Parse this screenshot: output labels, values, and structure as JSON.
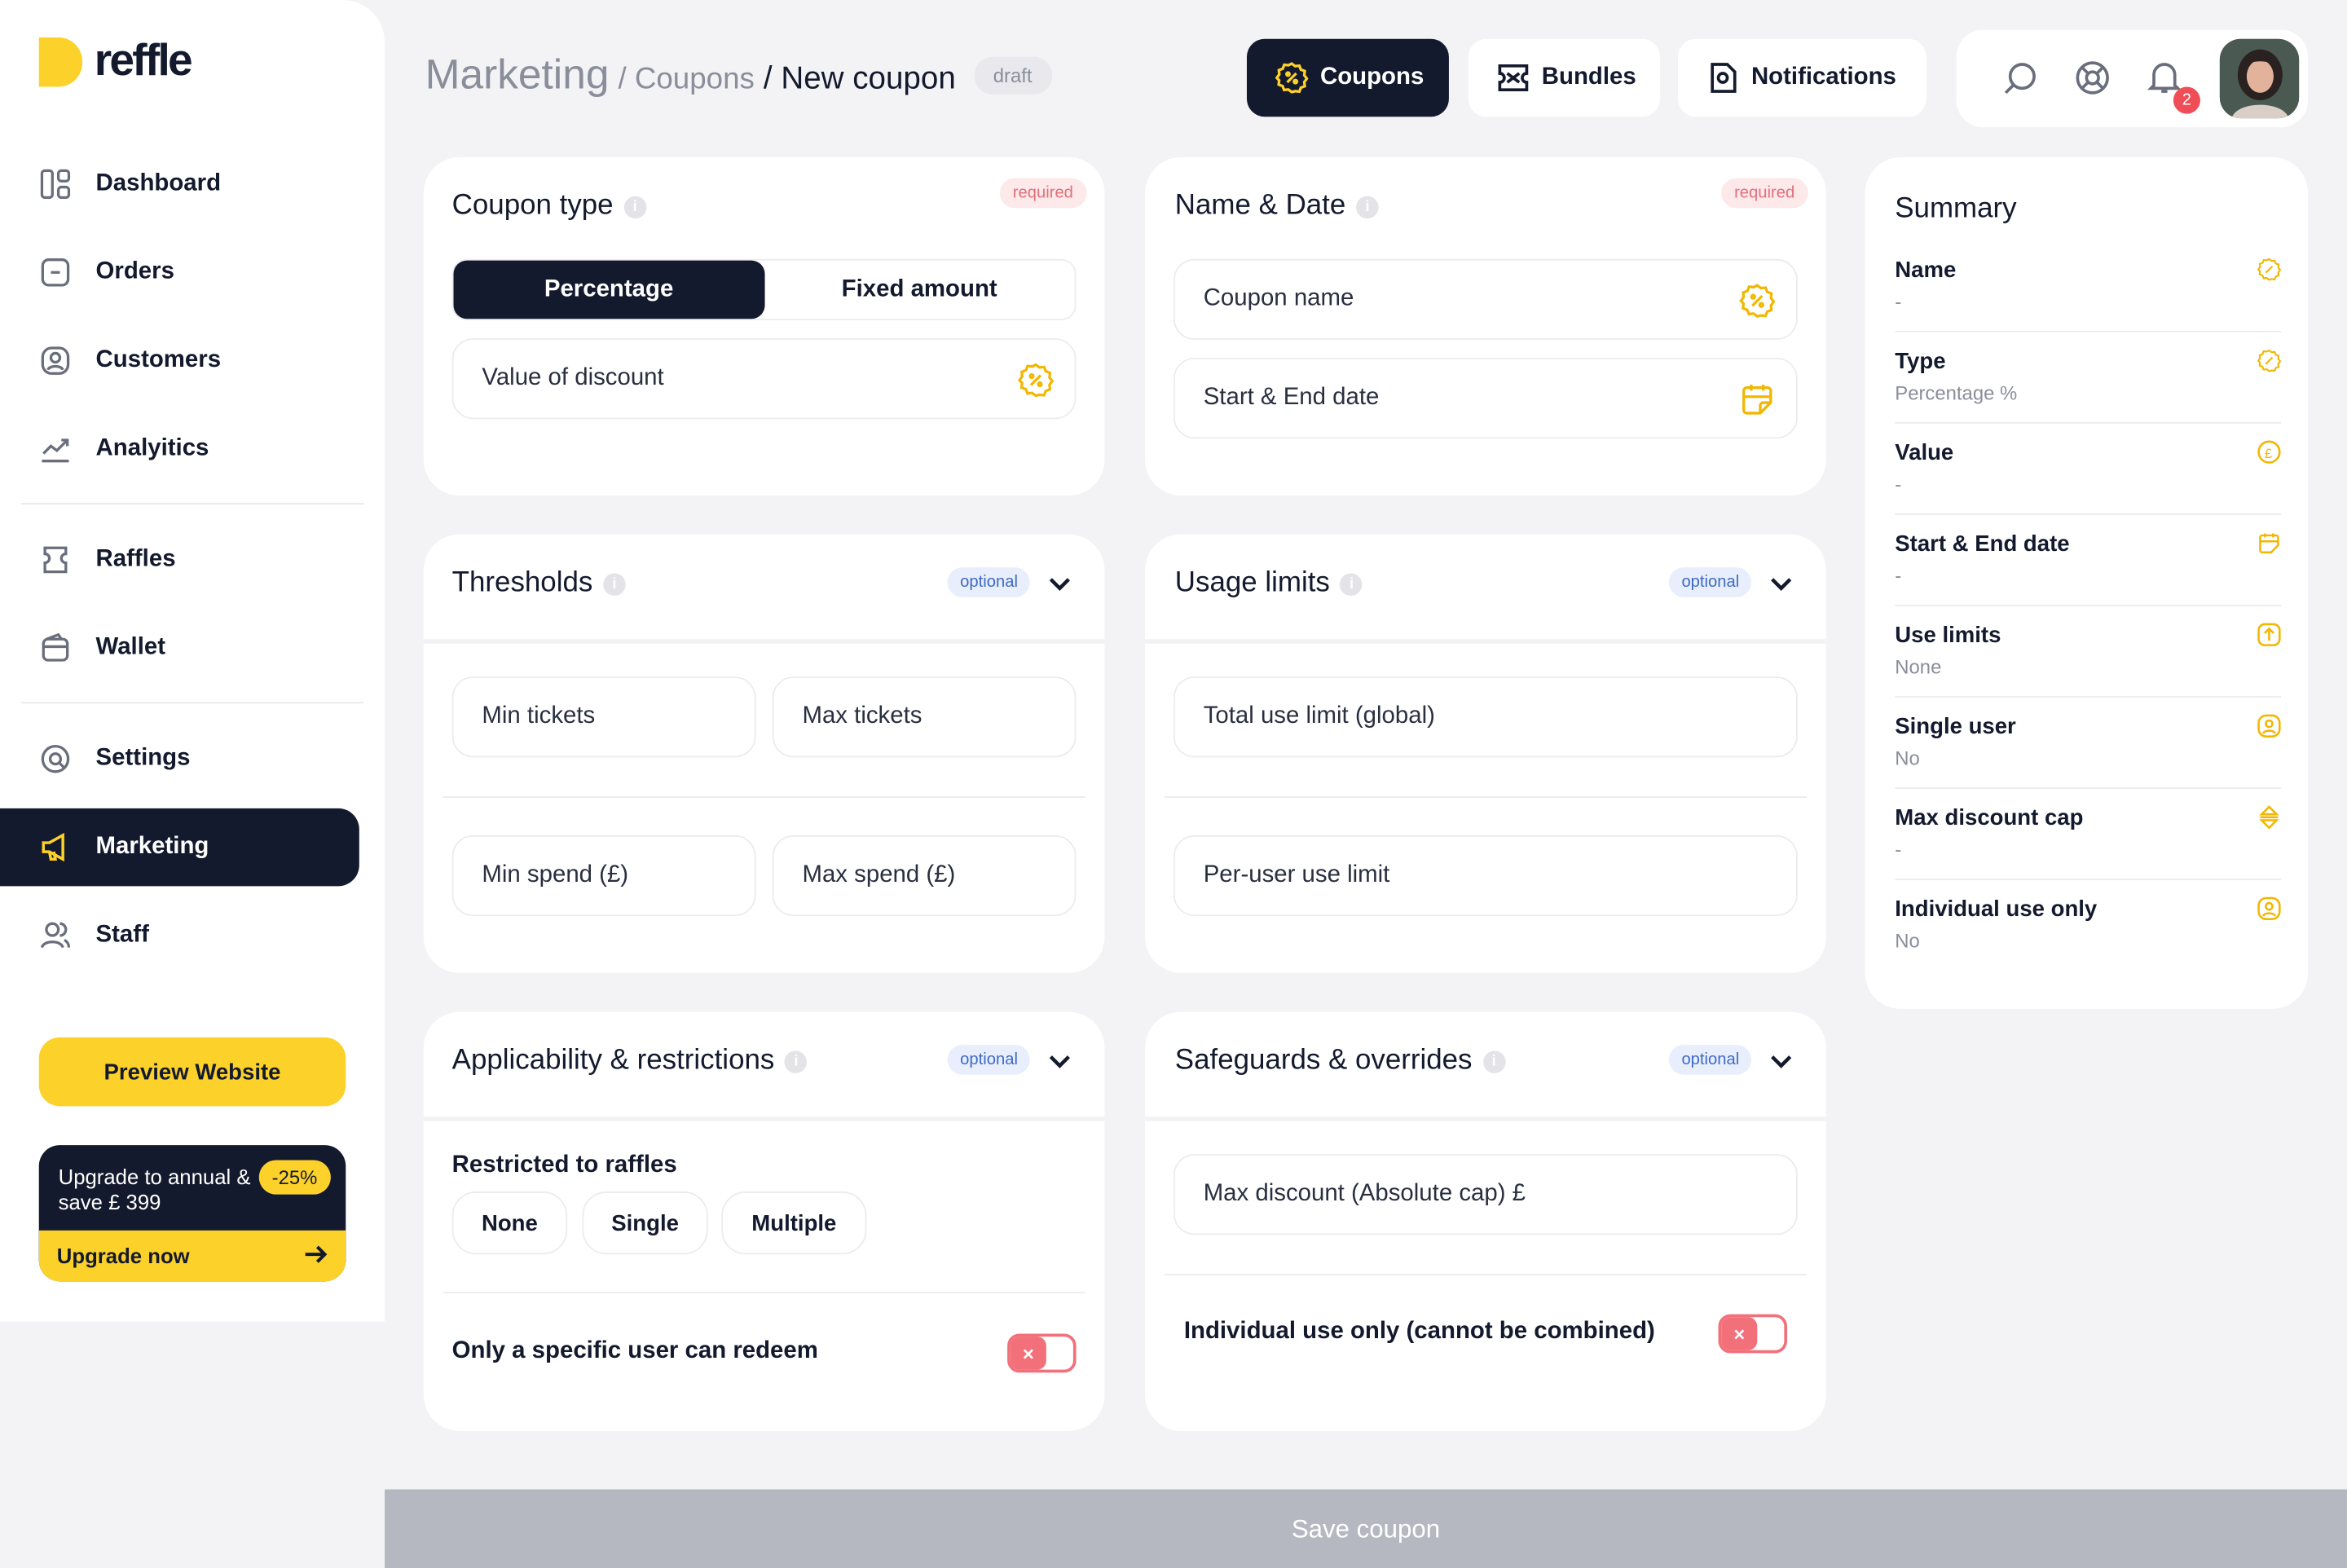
{
  "brand": {
    "name": "reffle",
    "accent": "#fcd12a",
    "dark": "#141a2e"
  },
  "sidebar": {
    "items": [
      {
        "label": "Dashboard",
        "icon": "dashboard-icon"
      },
      {
        "label": "Orders",
        "icon": "orders-icon"
      },
      {
        "label": "Customers",
        "icon": "customers-icon"
      },
      {
        "label": "Analyitics",
        "icon": "analytics-icon"
      },
      {
        "label": "Raffles",
        "icon": "raffles-icon"
      },
      {
        "label": "Wallet",
        "icon": "wallet-icon"
      },
      {
        "label": "Settings",
        "icon": "settings-icon"
      },
      {
        "label": "Marketing",
        "icon": "megaphone-icon",
        "active": true
      },
      {
        "label": "Staff",
        "icon": "staff-icon"
      }
    ],
    "preview_label": "Preview Website",
    "upgrade": {
      "text": "Upgrade to annual & save £ 399",
      "badge": "-25%",
      "cta": "Upgrade now"
    }
  },
  "header": {
    "crumb1": "Marketing",
    "crumb2": "/ Coupons",
    "crumb3": "/ New coupon",
    "status": "draft",
    "tabs": [
      {
        "label": "Coupons",
        "active": true
      },
      {
        "label": "Bundles"
      },
      {
        "label": "Notifications"
      }
    ],
    "notifications_count": "2"
  },
  "coupon_type": {
    "title": "Coupon type",
    "badge": "required",
    "options": [
      "Percentage",
      "Fixed amount"
    ],
    "selected": "Percentage",
    "value_placeholder": "Value of discount"
  },
  "name_date": {
    "title": "Name & Date",
    "badge": "required",
    "name_placeholder": "Coupon name",
    "date_placeholder": "Start & End date"
  },
  "thresholds": {
    "title": "Thresholds",
    "badge": "optional",
    "min_tickets": "Min tickets",
    "max_tickets": "Max tickets",
    "min_spend": "Min spend (£)",
    "max_spend": "Max spend (£)"
  },
  "usage_limits": {
    "title": "Usage limits",
    "badge": "optional",
    "total": "Total use limit (global)",
    "per_user": "Per-user use limit"
  },
  "applicability": {
    "title": "Applicability & restrictions",
    "badge": "optional",
    "restricted_label": "Restricted to raffles",
    "chips": [
      "None",
      "Single",
      "Multiple"
    ],
    "specific_user_label": "Only a specific user can redeem",
    "specific_user_on": false
  },
  "safeguards": {
    "title": "Safeguards & overrides",
    "badge": "optional",
    "max_discount": "Max discount (Absolute cap) £",
    "individual_label": "Individual use only (cannot be combined)",
    "individual_on": false
  },
  "summary": {
    "title": "Summary",
    "rows": [
      {
        "label": "Name",
        "value": "-",
        "icon": "coupon-icon"
      },
      {
        "label": "Type",
        "value": "Percentage %",
        "icon": "coupon-icon"
      },
      {
        "label": "Value",
        "value": "-",
        "icon": "pound-icon"
      },
      {
        "label": "Start & End date",
        "value": "-",
        "icon": "calendar-icon"
      },
      {
        "label": "Use limits",
        "value": "None",
        "icon": "limit-icon"
      },
      {
        "label": "Single user",
        "value": "No",
        "icon": "user-icon"
      },
      {
        "label": "Max discount cap",
        "value": "-",
        "icon": "cap-icon"
      },
      {
        "label": "Individual use only",
        "value": "No",
        "icon": "user-icon"
      }
    ]
  },
  "save_label": "Save coupon"
}
